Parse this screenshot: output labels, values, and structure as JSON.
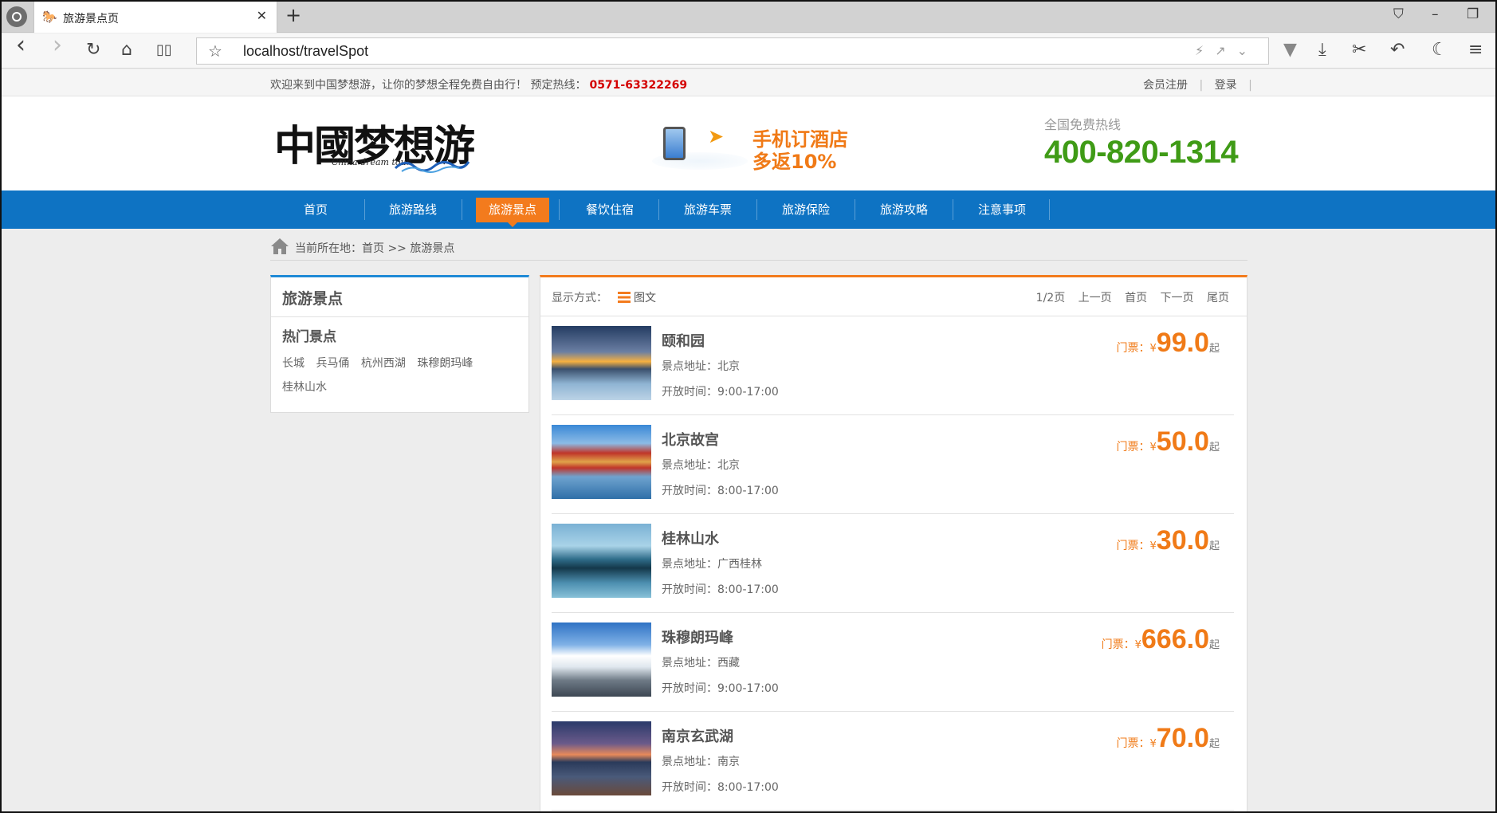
{
  "browser": {
    "tab_title": "旅游景点页",
    "address": "localhost/travelSpot",
    "icons": {
      "logo": "browser-logo-icon",
      "tab": "horse-icon",
      "close": "✕",
      "new_tab": "+",
      "back": "‹",
      "forward": "›",
      "reload": "↻",
      "home": "⌂",
      "reader": "📖",
      "star": "☆",
      "addr_tools": "⚡↗⌄",
      "shield": "▼",
      "download": "⤓",
      "scissors": "✂",
      "undo": "↶",
      "moon": "☾",
      "menu": "≡",
      "pin": "⌂",
      "minimize": "–",
      "restore": "❐"
    }
  },
  "topbar": {
    "welcome": "欢迎来到中国梦想游，让你的梦想全程免费自由行！ 预定热线：",
    "hotline": "0571-63322269",
    "register": "会员注册",
    "separator": "|",
    "login": "登录"
  },
  "header": {
    "logo_cn": "中國梦想游",
    "logo_en": "China dream tour",
    "promo_line1": "手机订酒店",
    "promo_line2": "多返10%",
    "free_label": "全国免费热线",
    "free_number": "400-820-1314"
  },
  "nav": {
    "items": [
      "首页",
      "旅游路线",
      "旅游景点",
      "餐饮住宿",
      "旅游车票",
      "旅游保险",
      "旅游攻略",
      "注意事项"
    ],
    "active": "旅游景点"
  },
  "breadcrumb": {
    "text": "当前所在地：首页 >> 旅游景点"
  },
  "sidebar": {
    "title": "旅游景点",
    "subtitle": "热门景点",
    "links": [
      "长城",
      "兵马俑",
      "杭州西湖",
      "珠穆朗玛峰",
      "桂林山水"
    ]
  },
  "list": {
    "display_label": "显示方式：",
    "view_mode": "图文",
    "pager": {
      "page": "1/2页",
      "prev": "上一页",
      "first": "首页",
      "next": "下一页",
      "last": "尾页"
    },
    "price_label": "门票：",
    "currency": "¥",
    "price_suffix": "起",
    "items": [
      {
        "name": "颐和园",
        "address": "景点地址：北京",
        "hours": "开放时间：9:00-17:00",
        "price": "99.0"
      },
      {
        "name": "北京故宫",
        "address": "景点地址：北京",
        "hours": "开放时间：8:00-17:00",
        "price": "50.0"
      },
      {
        "name": "桂林山水",
        "address": "景点地址：广西桂林",
        "hours": "开放时间：8:00-17:00",
        "price": "30.0"
      },
      {
        "name": "珠穆朗玛峰",
        "address": "景点地址：西藏",
        "hours": "开放时间：9:00-17:00",
        "price": "666.0"
      },
      {
        "name": "南京玄武湖",
        "address": "景点地址：南京",
        "hours": "开放时间：8:00-17:00",
        "price": "70.0"
      }
    ]
  }
}
